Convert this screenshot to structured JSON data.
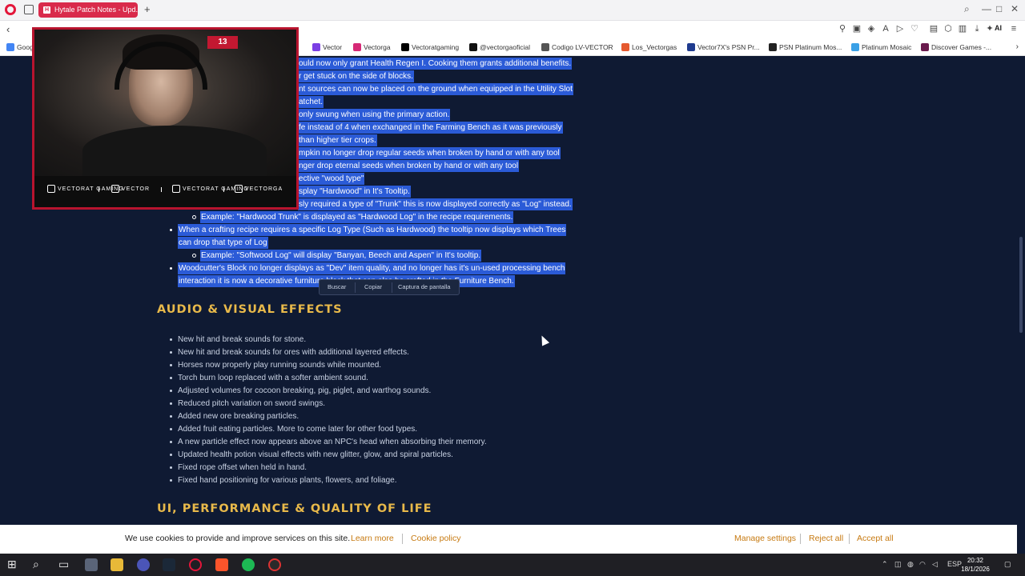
{
  "browser": {
    "tab_title": "Hytale Patch Notes - Upd...",
    "tab_favicon": "H",
    "ai_label": "AI",
    "bookmarks": [
      {
        "label": "Goog",
        "color": "#4285f4"
      },
      {
        "label": "Vector",
        "color": "#7b3fe4"
      },
      {
        "label": "Vectorga",
        "color": "#d62976"
      },
      {
        "label": "Vectoratgaming",
        "color": "#000000"
      },
      {
        "label": "@vectorgaoficial",
        "color": "#111111"
      },
      {
        "label": "Codigo LV-VECTOR",
        "color": "#555555"
      },
      {
        "label": "Los_Vectorgas",
        "color": "#e5592f"
      },
      {
        "label": "Vector7X's PSN Pr...",
        "color": "#1f3b8f"
      },
      {
        "label": "PSN Platinum Mos...",
        "color": "#222222"
      },
      {
        "label": "Platinum Mosaic",
        "color": "#3aa0e6"
      },
      {
        "label": "Discover Games -...",
        "color": "#6a1b4d"
      }
    ]
  },
  "webcam": {
    "badge": "13",
    "socials": [
      {
        "label": "VECTORAT GAMING",
        "icon": "youtube-icon"
      },
      {
        "label": "VECTOR",
        "icon": "twitch-icon"
      },
      {
        "label": "VECTORAT GAMING",
        "icon": "x-icon"
      },
      {
        "label": "VECTORGA",
        "icon": "instagram-icon"
      }
    ]
  },
  "article": {
    "highlighted_lines": [
      "ould now only grant Health Regen I. Cooking them grants additional benefits.",
      "r get stuck on the side of blocks.",
      "nt sources can now be placed on the ground when equipped in the Utility Slot",
      "atchet.",
      "only swung when using the primary action.",
      "fe instead of 4 when exchanged in the Farming Bench as it was previously",
      "than higher tier crops.",
      "mpkin no longer drop regular seeds when broken by hand or with any tool",
      "nger drop eternal seeds when broken by hand or with any tool",
      "Wood Logs now display their respective \"wood type\"",
      "splay \"Hardwood\" in It's Tooltip.",
      "sly required a type of \"Trunk\" this is now displayed correctly as \"Log\" instead.",
      "Example: \"Hardwood Trunk\" is displayed as \"Hardwood Log\" in the recipe requirements.",
      "When a crafting recipe requires a specific Log Type (Such as Hardwood) the tooltip now displays which Trees",
      "can drop that type of Log",
      "Example: \"Softwood Log\" will display \"Banyan, Beech and Aspen\" in It's tooltip.",
      "Woodcutter's Block no longer displays as \"Dev\" item quality, and no longer has it's un-used processing bench",
      "interaction it is now a decorative furniture block that can also be crafted in the Furniture Bench."
    ],
    "section_audio": {
      "title": "AUDIO & VISUAL EFFECTS",
      "items": [
        "New hit and break sounds for stone.",
        "New hit and break sounds for ores with additional layered effects.",
        "Horses now properly play running sounds while mounted.",
        "Torch burn loop replaced with a softer ambient sound.",
        "Adjusted volumes for cocoon breaking, pig, piglet, and warthog sounds.",
        "Reduced pitch variation on sword swings.",
        "Added new ore breaking particles.",
        "Added fruit eating particles. More to come later for other food types.",
        "A new particle effect now appears above an NPC's head when absorbing their memory.",
        "Updated health potion visual effects with new glitter, glow, and spiral particles.",
        "Fixed rope offset when held in hand.",
        "Fixed hand positioning for various plants, flowers, and foliage."
      ]
    },
    "section_ui": {
      "title": "UI, PERFORMANCE & QUALITY OF LIFE"
    }
  },
  "context_menu": {
    "items": [
      "Buscar",
      "Copiar",
      "Captura de pantalla"
    ]
  },
  "cookie": {
    "text": "We use cookies to provide and improve services on this site.",
    "learn_more": "Learn more",
    "policy": "Cookie policy",
    "manage": "Manage settings",
    "reject": "Reject all",
    "accept": "Accept all"
  },
  "taskbar": {
    "lang": "ESP",
    "time": "20:32",
    "date": "18/1/2026"
  },
  "colors": {
    "page_bg": "#0f1a33",
    "highlight": "#2b5bd7",
    "heading": "#e8b94a",
    "brand_red": "#d92a4b"
  }
}
